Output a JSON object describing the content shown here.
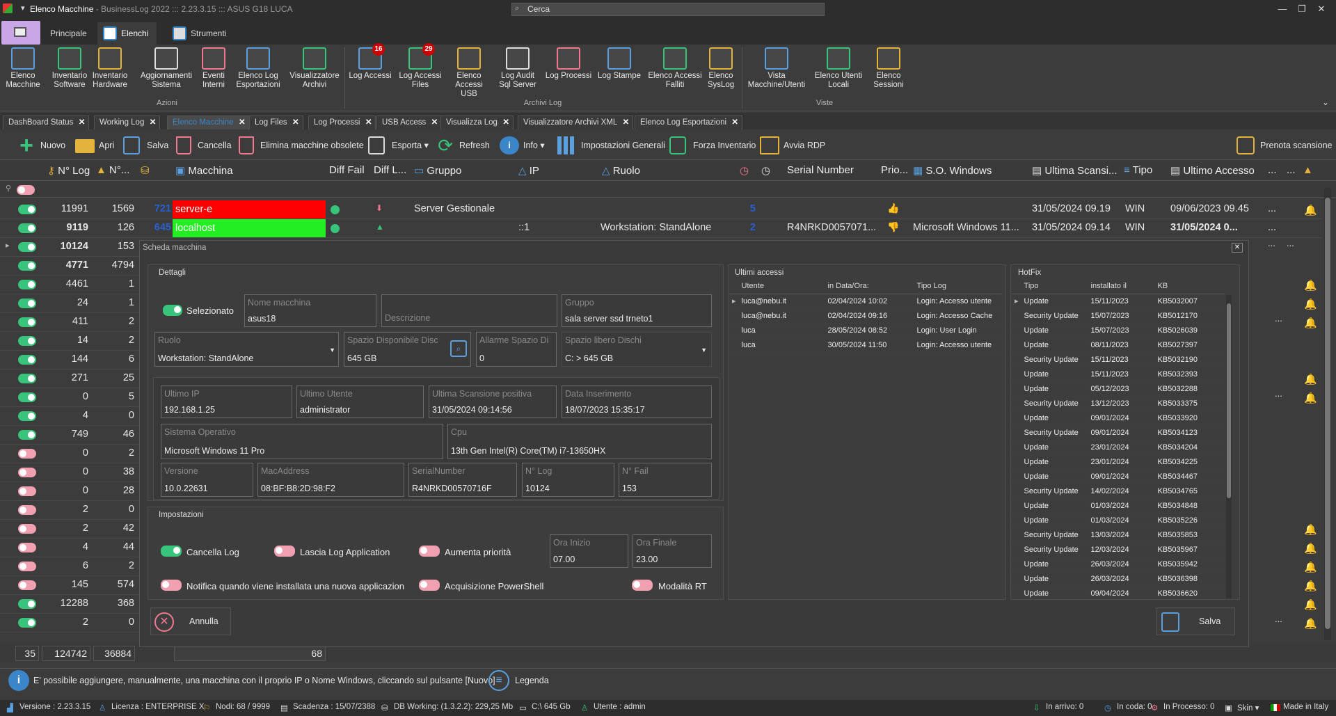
{
  "app": {
    "title": "Elenco Macchine",
    "subtitle": " - BusinessLog 2022 ::: 2.23.3.15 ::: ASUS G18 LUCA",
    "search_placeholder": "Cerca"
  },
  "ribbon_tabs": [
    {
      "label": "Principale"
    },
    {
      "label": "Elenchi"
    },
    {
      "label": "Strumenti"
    }
  ],
  "ribbon": {
    "azioni": [
      {
        "label": "Elenco\nMacchine"
      },
      {
        "label": "Inventario\nSoftware"
      },
      {
        "label": "Inventario\nHardware"
      },
      {
        "label": "Aggiornamenti\nSistema"
      },
      {
        "label": "Eventi\nInterni"
      },
      {
        "label": "Elenco Log\nEsportazioni"
      },
      {
        "label": "Visualizzatore\nArchivi"
      }
    ],
    "archivi": [
      {
        "label": "Log Accessi",
        "badge": "16"
      },
      {
        "label": "Log Accessi\nFiles",
        "badge": "29"
      },
      {
        "label": "Elenco\nAccessi USB"
      },
      {
        "label": "Log Audit\nSql Server"
      },
      {
        "label": "Log Processi"
      },
      {
        "label": "Log Stampe"
      },
      {
        "label": "Elenco Accessi\nFalliti"
      },
      {
        "label": "Elenco\nSysLog"
      }
    ],
    "viste": [
      {
        "label": "Vista\nMacchine/Utenti"
      },
      {
        "label": "Elenco Utenti\nLocali"
      },
      {
        "label": "Elenco\nSessioni"
      }
    ],
    "group_azioni": "Azioni",
    "group_archivi": "Archivi Log",
    "group_viste": "Viste"
  },
  "doc_tabs": [
    "DashBoard Status",
    "Working Log",
    "Elenco Macchine",
    "Log Files",
    "Log Processi",
    "USB Access",
    "Visualizza Log",
    "Visualizzatore Archivi XML",
    "Elenco Log Esportazioni"
  ],
  "toolbar": {
    "nuovo": "Nuovo",
    "apri": "Apri",
    "salva": "Salva",
    "cancella": "Cancella",
    "elimina": "Elimina macchine obsolete",
    "esporta": "Esporta",
    "refresh": "Refresh",
    "info": "Info",
    "impostazioni": "Impostazioni Generali",
    "forza": "Forza Inventario",
    "rdp": "Avvia RDP",
    "prenota": "Prenota scansione"
  },
  "grid": {
    "headers": {
      "nlog": "N° Log",
      "nfail": "N°...",
      "macchina": "Macchina",
      "difffail": "Diff Fail",
      "difflog": "Diff L...",
      "gruppo": "Gruppo",
      "ip": "IP",
      "ruolo": "Ruolo",
      "serial": "Serial Number",
      "prio": "Prio...",
      "os": "S.O. Windows",
      "ultscan": "Ultima Scansi...",
      "tipo": "Tipo",
      "ultacc": "Ultimo Accesso"
    },
    "rows": [
      {
        "on": true,
        "nlog": "11991",
        "nfail": "1569",
        "c3": "721",
        "name": "server-e",
        "gruppo": "Server Gestionale",
        "ip": "",
        "ruolo": "",
        "n": "5",
        "serial": "",
        "os": "",
        "scan": "31/05/2024 09.19",
        "tipo": "WIN",
        "acc": "09/06/2023 09.45",
        "bell": true
      },
      {
        "on": true,
        "nlog": "9119",
        "nfail": "126",
        "c3": "645",
        "name": "localhost",
        "gruppo": "",
        "ip": "::1",
        "ruolo": "Workstation: StandAlone",
        "n": "2",
        "serial": "R4NRKD0057071...",
        "os": "Microsoft Windows 11...",
        "scan": "31/05/2024 09.14",
        "tipo": "WIN",
        "acc": "31/05/2024 0...",
        "bell": false
      }
    ],
    "left_rows": [
      {
        "on": true,
        "nlog": "10124",
        "nfail": "153"
      },
      {
        "on": true,
        "nlog": "4771",
        "nfail": "4794"
      },
      {
        "on": true,
        "nlog": "4461",
        "nfail": "1"
      },
      {
        "on": true,
        "nlog": "24",
        "nfail": "1"
      },
      {
        "on": true,
        "nlog": "411",
        "nfail": "2"
      },
      {
        "on": true,
        "nlog": "14",
        "nfail": "2"
      },
      {
        "on": true,
        "nlog": "144",
        "nfail": "6"
      },
      {
        "on": true,
        "nlog": "271",
        "nfail": "25"
      },
      {
        "on": true,
        "nlog": "0",
        "nfail": "5"
      },
      {
        "on": true,
        "nlog": "4",
        "nfail": "0"
      },
      {
        "on": true,
        "nlog": "749",
        "nfail": "46"
      },
      {
        "on": false,
        "nlog": "0",
        "nfail": "2"
      },
      {
        "on": false,
        "nlog": "0",
        "nfail": "38"
      },
      {
        "on": false,
        "nlog": "0",
        "nfail": "28"
      },
      {
        "on": false,
        "nlog": "2",
        "nfail": "0"
      },
      {
        "on": false,
        "nlog": "2",
        "nfail": "42"
      },
      {
        "on": false,
        "nlog": "4",
        "nfail": "44"
      },
      {
        "on": false,
        "nlog": "6",
        "nfail": "2"
      },
      {
        "on": false,
        "nlog": "145",
        "nfail": "574"
      },
      {
        "on": true,
        "nlog": "12288",
        "nfail": "368"
      },
      {
        "on": true,
        "nlog": "2",
        "nfail": "0"
      }
    ],
    "footer": {
      "count": "35",
      "nlog": "124742",
      "nfail": "36884",
      "c3": "68"
    }
  },
  "modal": {
    "title": "Scheda macchina",
    "dettagli": "Dettagli",
    "selezionato": "Selezionato",
    "nome_lbl": "Nome macchina",
    "nome": "asus18",
    "desc_lbl": "Descrizione",
    "desc": "",
    "gruppo_lbl": "Gruppo",
    "gruppo": "sala server ssd trneto1",
    "ruolo_lbl": "Ruolo",
    "ruolo": "Workstation: StandAlone",
    "spazio_lbl": "Spazio Disponibile Disc",
    "spazio": "645 GB",
    "allarme_lbl": "Allarme Spazio Di",
    "allarme": "0",
    "libero_lbl": "Spazio libero Dischi",
    "libero": "C: > 645 GB",
    "ip_lbl": "Ultimo IP",
    "ip": "192.168.1.25",
    "utente_lbl": "Ultimo Utente",
    "utente": "administrator",
    "scan_lbl": "Ultima Scansione positiva",
    "scan": "31/05/2024 09:14:56",
    "ins_lbl": "Data Inserimento",
    "ins": "18/07/2023 15:35:17",
    "so_lbl": "Sistema Operativo",
    "so": "Microsoft Windows 11 Pro",
    "cpu_lbl": "Cpu",
    "cpu": "13th Gen Intel(R) Core(TM) i7-13650HX",
    "ver_lbl": "Versione",
    "ver": "10.0.22631",
    "mac_lbl": "MacAddress",
    "mac": "08:BF:B8:2D:98:F2",
    "sn_lbl": "SerialNumber",
    "sn": "R4NRKD00570716F",
    "nlog_lbl": "N° Log",
    "nlog": "10124",
    "nfail_lbl": "N° Fail",
    "nfail": "153",
    "impostazioni": "Impostazioni",
    "cancella_log": "Cancella Log",
    "lascia_log": "Lascia Log Application",
    "aumenta": "Aumenta priorità",
    "ora_inizio_lbl": "Ora Inizio",
    "ora_inizio": "07.00",
    "ora_finale_lbl": "Ora Finale",
    "ora_finale": "23.00",
    "notifica": "Notifica quando viene installata una nuova applicazion",
    "powershell": "Acquisizione PowerShell",
    "rt": "Modalità RT",
    "annulla": "Annulla",
    "salva": "Salva",
    "accessi_title": "Ultimi accessi",
    "accessi_cols": [
      "Utente",
      "in Data/Ora:",
      "Tipo Log"
    ],
    "accessi": [
      [
        "luca@nebu.it",
        "02/04/2024 10:02",
        "Login: Accesso utente"
      ],
      [
        "luca@nebu.it",
        "02/04/2024 09:16",
        "Login: Accesso Cache"
      ],
      [
        "luca",
        "28/05/2024 08:52",
        "Login: User Login"
      ],
      [
        "luca",
        "30/05/2024 11:50",
        "Login: Accesso utente"
      ]
    ],
    "hotfix_title": "HotFix",
    "hotfix_cols": [
      "Tipo",
      "installato il",
      "KB"
    ],
    "hotfix": [
      [
        "Update",
        "15/11/2023",
        "KB5032007"
      ],
      [
        "Security Update",
        "15/07/2023",
        "KB5012170"
      ],
      [
        "Update",
        "15/07/2023",
        "KB5026039"
      ],
      [
        "Update",
        "08/11/2023",
        "KB5027397"
      ],
      [
        "Security Update",
        "15/11/2023",
        "KB5032190"
      ],
      [
        "Update",
        "15/11/2023",
        "KB5032393"
      ],
      [
        "Update",
        "05/12/2023",
        "KB5032288"
      ],
      [
        "Security Update",
        "13/12/2023",
        "KB5033375"
      ],
      [
        "Update",
        "09/01/2024",
        "KB5033920"
      ],
      [
        "Security Update",
        "09/01/2024",
        "KB5034123"
      ],
      [
        "Update",
        "23/01/2024",
        "KB5034204"
      ],
      [
        "Update",
        "23/01/2024",
        "KB5034225"
      ],
      [
        "Update",
        "09/01/2024",
        "KB5034467"
      ],
      [
        "Security Update",
        "14/02/2024",
        "KB5034765"
      ],
      [
        "Update",
        "01/03/2024",
        "KB5034848"
      ],
      [
        "Update",
        "01/03/2024",
        "KB5035226"
      ],
      [
        "Security Update",
        "13/03/2024",
        "KB5035853"
      ],
      [
        "Security Update",
        "12/03/2024",
        "KB5035967"
      ],
      [
        "Update",
        "26/03/2024",
        "KB5035942"
      ],
      [
        "Update",
        "26/03/2024",
        "KB5036398"
      ],
      [
        "Update",
        "09/04/2024",
        "KB5036620"
      ]
    ]
  },
  "infobar": {
    "text": "E' possibile aggiungere, manualmente, una macchina con il proprio IP o Nome Windows, cliccando sul pulsante [Nuovo]",
    "legenda": "Legenda"
  },
  "status": {
    "versione": "Versione : 2.23.3.15",
    "licenza": "Licenza : ENTERPRISE X",
    "nodi": "Nodi: 68 / 9999",
    "scadenza": "Scadenza : 15/07/2388",
    "db": "DB Working: (1.3.2.2): 229,25 Mb",
    "disk": "C:\\ 645 Gb",
    "utente": "Utente : admin",
    "arrivo": "In arrivo: 0",
    "coda": "In coda: 0",
    "processo": "In Processo: 0",
    "skin": "Skin",
    "made": "Made in Italy"
  },
  "colors": {
    "accent": "#3a86c8",
    "green": "#38c47b",
    "pink": "#f0a0b0",
    "red": "#ff0000",
    "bell": "#e01010"
  }
}
